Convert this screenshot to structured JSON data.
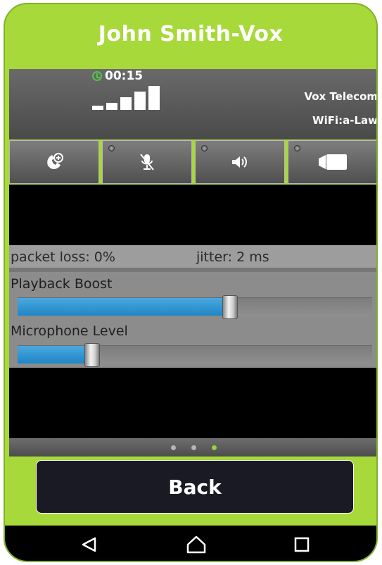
{
  "window": {
    "title": "John Smith-Vox"
  },
  "status": {
    "call_time": "00:15",
    "signal_bars": 5,
    "carrier": "Vox Telecom",
    "codec": "WiFi:a-Law"
  },
  "controls": [
    {
      "name": "hold-call",
      "icon": "phone-hold-icon"
    },
    {
      "name": "mute",
      "icon": "microphone-muted-icon"
    },
    {
      "name": "speaker",
      "icon": "speaker-icon"
    },
    {
      "name": "video",
      "icon": "video-camera-icon"
    }
  ],
  "stats": {
    "packet_loss": "packet loss: 0%",
    "jitter": "jitter: 2 ms"
  },
  "sliders": {
    "playback": {
      "label": "Playback Boost",
      "value": 0.6
    },
    "microphone": {
      "label": "Microphone Level",
      "value": 0.21
    }
  },
  "pager": {
    "pages": 3,
    "active": 3
  },
  "back_button": {
    "label": "Back"
  },
  "nav": {
    "back_icon": "triangle-back-icon",
    "home_icon": "home-icon",
    "recents_icon": "square-recents-icon"
  },
  "colors": {
    "frame": "#a7d93a",
    "slider_fill": "#1f86c6",
    "active_dot": "#8fd63a",
    "status_led": "#52c64a"
  }
}
